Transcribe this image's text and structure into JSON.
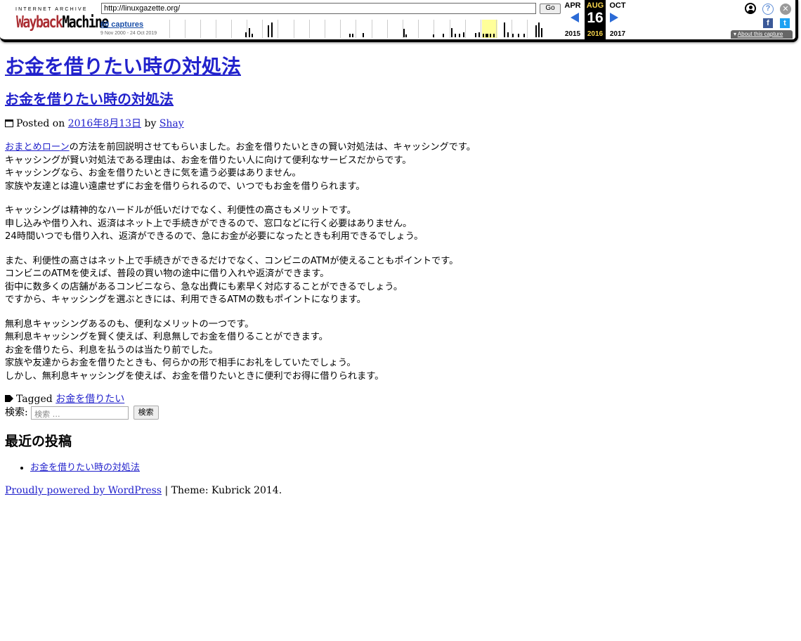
{
  "toolbar": {
    "logo_top": "INTERNET ARCHIVE",
    "logo_main_1": "Wayback",
    "logo_main_2": "Machine",
    "url": "http://linuxgazette.org/",
    "go_label": "Go",
    "captures_link": "60 captures",
    "date_range": "9 Nov 2000 - 24 Oct 2019",
    "prev_month": "APR",
    "current_month": "AUG",
    "next_month": "OCT",
    "current_day": "16",
    "prev_year": "2015",
    "current_year": "2016",
    "next_year": "2017",
    "about_label": "About this capture",
    "help_glyph": "?",
    "close_glyph": "✕",
    "fb_glyph": "f",
    "tw_glyph": "t",
    "colors": {
      "accent_blue": "#2c6bd6",
      "highlight": "#f7d44c",
      "logo_red": "#ab2e33"
    }
  },
  "site": {
    "title": "お金を借りたい時の対処法"
  },
  "post": {
    "title": "お金を借りたい時の対処法",
    "posted_on_label": "Posted on",
    "date": "2016年8月13日",
    "by_label": "by",
    "author": "Shay",
    "p1": {
      "link": "おまとめローン",
      "line1_rest": "の方法を前回説明させてもらいました。お金を借りたいときの賢い対処法は、キャッシングです。",
      "line2": "キャッシングが賢い対処法である理由は、お金を借りたい人に向けて便利なサービスだからです。",
      "line3": "キャッシングなら、お金を借りたいときに気を遣う必要はありません。",
      "line4": "家族や友達とは違い遠慮せずにお金を借りられるので、いつでもお金を借りられます。"
    },
    "p2": [
      "キャッシングは精神的なハードルが低いだけでなく、利便性の高さもメリットです。",
      "申し込みや借り入れ、返済はネット上で手続きができるので、窓口などに行く必要はありません。",
      "24時間いつでも借り入れ、返済ができるので、急にお金が必要になったときも利用できるでしょう。"
    ],
    "p3": [
      "また、利便性の高さはネット上で手続きができるだけでなく、コンビニのATMが使えることもポイントです。",
      "コンビニのATMを使えば、普段の買い物の途中に借り入れや返済ができます。",
      "街中に数多くの店舗があるコンビニなら、急な出費にも素早く対応することができるでしょう。",
      "ですから、キャッシングを選ぶときには、利用できるATMの数もポイントになります。"
    ],
    "p4": [
      "無利息キャッシングあるのも、便利なメリットの一つです。",
      "無利息キャッシングを賢く使えば、利息無しでお金を借りることができます。",
      "お金を借りたら、利息を払うのは当たり前でした。",
      "家族や友達からお金を借りたときも、何らかの形で相手にお礼をしていたでしょう。",
      "しかし、無利息キャッシングを使えば、お金を借りたいときに便利でお得に借りられます。"
    ],
    "tagged_label": "Tagged",
    "tag": "お金を借りたい"
  },
  "search": {
    "label": "検索:",
    "placeholder": "検索 …",
    "button": "検索"
  },
  "recent": {
    "title": "最近の投稿",
    "items": [
      "お金を借りたい時の対処法"
    ]
  },
  "footer": {
    "powered_link": "Proudly powered by WordPress",
    "theme_text": "| Theme: Kubrick 2014."
  }
}
